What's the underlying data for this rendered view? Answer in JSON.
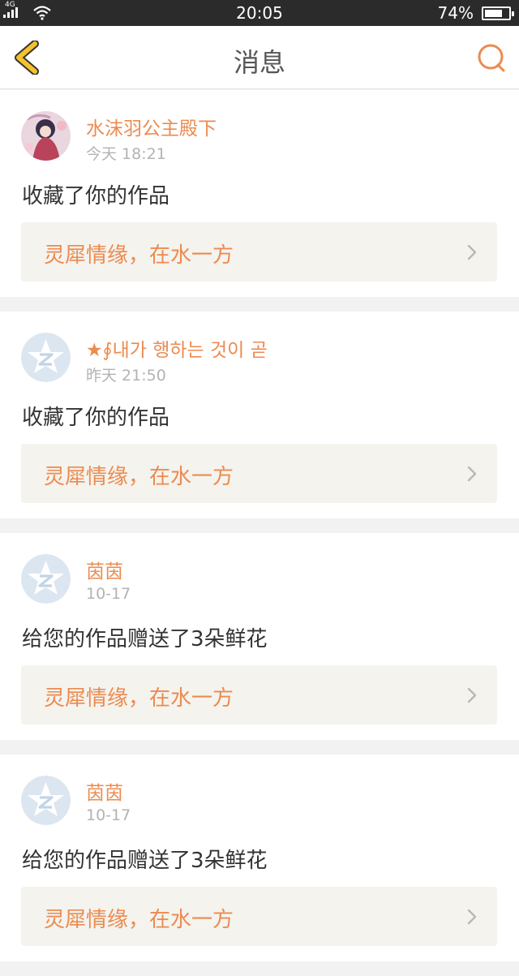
{
  "status_bar": {
    "network": "4G",
    "time": "20:05",
    "battery_percent": "74%",
    "battery_level": 0.74
  },
  "header": {
    "title": "消息",
    "back_icon": "chevron-left-icon",
    "search_icon": "search-icon"
  },
  "colors": {
    "accent": "#ec8b50",
    "back_icon": "#f5c22a",
    "card_bg": "#ffffff",
    "work_bg": "#f4f3ee",
    "page_bg": "#f2f2f2"
  },
  "messages": [
    {
      "user": "水沫羽公主殿下",
      "time": "今天 18:21",
      "action": "收藏了你的作品",
      "work": "灵犀情缘，在水一方",
      "avatar": "photo-avatar"
    },
    {
      "user": "★∮내가 행하는 것이 곧",
      "time": "昨天 21:50",
      "action": "收藏了你的作品",
      "work": "灵犀情缘，在水一方",
      "avatar": "default-z-avatar"
    },
    {
      "user": "茵茵",
      "time": "10-17",
      "action": "给您的作品赠送了3朵鲜花",
      "work": "灵犀情缘，在水一方",
      "avatar": "default-z-avatar"
    },
    {
      "user": "茵茵",
      "time": "10-17",
      "action": "给您的作品赠送了3朵鲜花",
      "work": "灵犀情缘，在水一方",
      "avatar": "default-z-avatar"
    }
  ]
}
